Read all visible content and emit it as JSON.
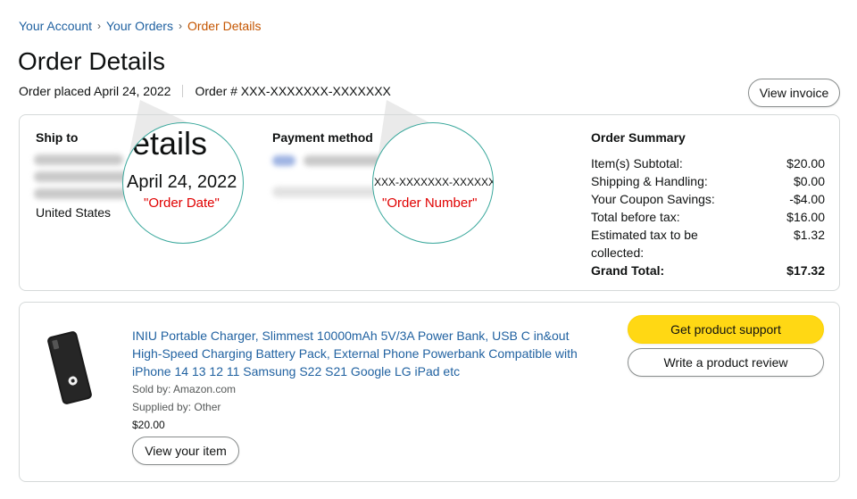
{
  "breadcrumb": {
    "items": [
      "Your Account",
      "Your Orders"
    ],
    "current": "Order Details",
    "separator": "›"
  },
  "page_title": "Order Details",
  "order_meta": {
    "placed": "Order placed April 24, 2022",
    "order_number": "Order # XXX-XXXXXXX-XXXXXXX"
  },
  "buttons": {
    "view_invoice": "View invoice",
    "get_support": "Get product support",
    "write_review": "Write a product review",
    "view_item": "View your item"
  },
  "ship_to": {
    "heading": "Ship to",
    "country": "United States"
  },
  "payment": {
    "heading": "Payment method"
  },
  "order_summary": {
    "heading": "Order Summary",
    "rows": [
      {
        "label": "Item(s) Subtotal:",
        "value": "$20.00"
      },
      {
        "label": "Shipping & Handling:",
        "value": "$0.00"
      },
      {
        "label": "Your Coupon Savings:",
        "value": "-$4.00"
      },
      {
        "label": "Total before tax:",
        "value": "$16.00"
      },
      {
        "label": "Estimated tax to be collected:",
        "value": "$1.32"
      }
    ],
    "grand_total": {
      "label": "Grand Total:",
      "value": "$17.32"
    }
  },
  "annotations": {
    "date_partial_title": "etails",
    "date_zoom": "April 24, 2022",
    "date_label": "\"Order Date\"",
    "number_zoom": "XXX-XXXXXXX-XXXXXXX",
    "number_label": "\"Order Number\"",
    "accent_color": "#3aa89c",
    "label_color": "#e00000"
  },
  "product": {
    "title": "INIU Portable Charger, Slimmest 10000mAh 5V/3A Power Bank, USB C in&out High-Speed Charging Battery Pack, External Phone Powerbank Compatible with iPhone 14 13 12 11 Samsung S22 S21 Google LG iPad etc",
    "sold_by": "Sold by: Amazon.com",
    "supplied_by": "Supplied by: Other",
    "price": "$20.00",
    "image_icon": "power-bank-image"
  },
  "colors": {
    "link": "#2162a1",
    "breadcrumb_current": "#c45500",
    "support_button": "#ffd814"
  }
}
